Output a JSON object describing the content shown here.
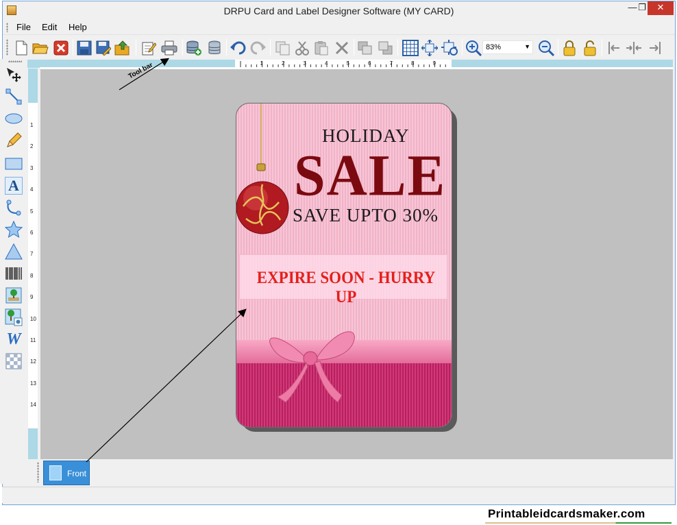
{
  "window": {
    "title": "DRPU Card and Label Designer Software  (MY CARD)",
    "controls": {
      "minimize": "—",
      "maximize": "❐",
      "close": "✕"
    }
  },
  "menu": {
    "items": [
      {
        "label": "File",
        "icon": ""
      },
      {
        "label": "Edit",
        "icon": ""
      },
      {
        "label": "Help",
        "icon": ""
      }
    ]
  },
  "toolbar": {
    "buttons": [
      {
        "name": "new-icon"
      },
      {
        "name": "open-folder-icon"
      },
      {
        "name": "close-document-icon"
      },
      {
        "name": "save-icon"
      },
      {
        "name": "save-as-icon"
      },
      {
        "name": "export-icon"
      },
      {
        "name": "edit-icon"
      },
      {
        "name": "print-icon"
      },
      {
        "name": "database-add-icon"
      },
      {
        "name": "database-icon"
      },
      {
        "name": "undo-icon"
      },
      {
        "name": "redo-icon"
      },
      {
        "name": "copy-icon"
      },
      {
        "name": "cut-icon"
      },
      {
        "name": "paste-icon"
      },
      {
        "name": "delete-icon"
      },
      {
        "name": "bring-forward-icon"
      },
      {
        "name": "send-backward-icon"
      },
      {
        "name": "grid-icon"
      },
      {
        "name": "center-icon"
      },
      {
        "name": "fit-icon"
      },
      {
        "name": "zoom-in-icon"
      },
      {
        "name": "zoom-out-icon"
      },
      {
        "name": "lock-icon"
      },
      {
        "name": "unlock-icon"
      },
      {
        "name": "align-left-icon"
      },
      {
        "name": "align-center-icon"
      },
      {
        "name": "align-right-icon"
      }
    ],
    "zoom_value": "83%",
    "annotation": "Tool bar"
  },
  "tools": [
    {
      "name": "pointer-icon"
    },
    {
      "name": "line-icon"
    },
    {
      "name": "ellipse-icon"
    },
    {
      "name": "pencil-icon"
    },
    {
      "name": "rectangle-icon"
    },
    {
      "name": "text-icon",
      "glyph": "A"
    },
    {
      "name": "curve-icon"
    },
    {
      "name": "star-icon"
    },
    {
      "name": "triangle-icon"
    },
    {
      "name": "barcode-icon"
    },
    {
      "name": "image-icon"
    },
    {
      "name": "image-library-icon"
    },
    {
      "name": "word-art-icon",
      "glyph": "W"
    },
    {
      "name": "watermark-icon"
    }
  ],
  "rulers": {
    "horizontal": [
      "1",
      "2",
      "3",
      "4",
      "5",
      "6",
      "7",
      "8",
      "9"
    ],
    "vertical": [
      "1",
      "2",
      "3",
      "4",
      "5",
      "6",
      "7",
      "8",
      "9",
      "10",
      "11",
      "12",
      "13",
      "14"
    ]
  },
  "card": {
    "line1": "HOLIDAY",
    "line2": "SALE",
    "line3": "SAVE UPTO 30%",
    "line4": "EXPIRE SOON - HURRY UP",
    "colors": {
      "sale": "#7b0a10",
      "expire": "#e4201b",
      "background": "#f7c6d6",
      "bottom": "#c42a6a"
    }
  },
  "tabs": [
    {
      "label": "Front"
    }
  ],
  "brand": "Printableidcardsmaker.com",
  "colors": {
    "ruler": "#add8e6",
    "canvas": "#c0c0c0",
    "tab": "#3a90d8",
    "close": "#c7362a"
  }
}
